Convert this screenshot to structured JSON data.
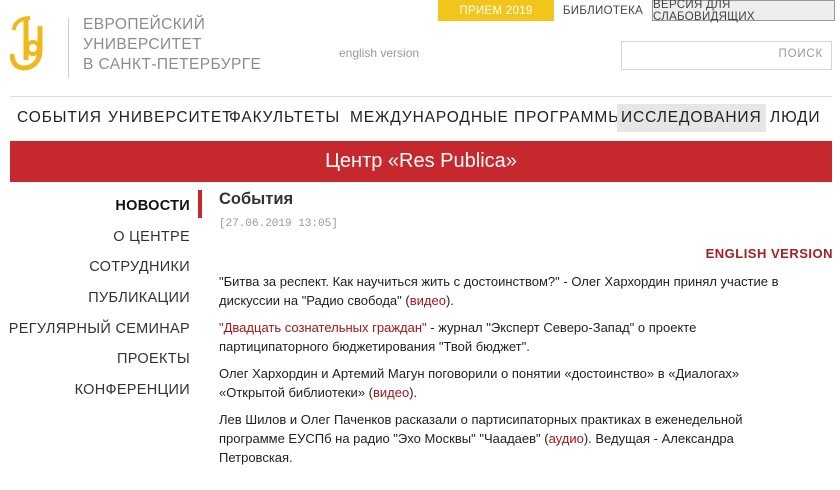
{
  "header": {
    "logo_lines": [
      "ЕВРОПЕЙСКИЙ",
      "УНИВЕРСИТЕТ",
      "В САНКТ-ПЕТЕРБУРГЕ"
    ],
    "english_link": "english version",
    "top_buttons": {
      "priem": "ПРИЕМ 2019",
      "library": "БИБЛИОТЕКА",
      "vision": "ВЕРСИЯ ДЛЯ СЛАБОВИДЯЩИХ"
    },
    "search": {
      "placeholder": "",
      "button": "ПОИСК"
    }
  },
  "nav": {
    "items": [
      "СОБЫТИЯ",
      "УНИВЕРСИТЕТ",
      "ФАКУЛЬТЕТЫ",
      "МЕЖДУНАРОДНЫЕ ПРОГРАММЫ",
      "ИССЛЕДОВАНИЯ",
      "ЛЮДИ"
    ],
    "active": "ИССЛЕДОВАНИЯ"
  },
  "banner": {
    "title": "Центр «Res Publica»"
  },
  "sidebar": {
    "items": [
      "НОВОСТИ",
      "О ЦЕНТРЕ",
      "СОТРУДНИКИ",
      "ПУБЛИКАЦИИ",
      "РЕГУЛЯРНЫЙ СЕМИНАР",
      "ПРОЕКТЫ",
      "КОНФЕРЕНЦИИ"
    ]
  },
  "main": {
    "title": "События",
    "date": "[27.06.2019 13:05]",
    "english_version": "ENGLISH VERSION",
    "paragraphs": [
      {
        "text_before": "\"Битва за респект. Как научиться жить с достоинством?\" - Олег Хархордин принял участие в дискуссии на \"Радио свобода\" (",
        "link": "видео",
        "text_after": ")."
      },
      {
        "link": "\"Двадцать сознательных граждан\"",
        "text_after": " - журнал \"Эксперт Северо-Запад\" о проекте партиципаторного бюджетирования \"Твой бюджет\"."
      },
      {
        "text_before": "Олег Хархордин и Артемий Магун поговорили о понятии «достоинство» в «Диалогах» «Открытой библиотеки» (",
        "link": "видео",
        "text_after": ")."
      },
      {
        "text_before": "Лев Шилов и Олег Паченков расказали о партисипаторных практиках в еженедельной программе ЕУСПб на радио \"Эхо Москвы\" \"Чаадаев\" (",
        "link": "аудио",
        "text_after": "). Ведущая - Александра Петровская."
      }
    ]
  },
  "colors": {
    "brand_red": "#c7282d",
    "accent_yellow": "#f2c51b",
    "link_red": "#a0181a"
  },
  "icons": {
    "logo": "eu-spiral-logo"
  }
}
